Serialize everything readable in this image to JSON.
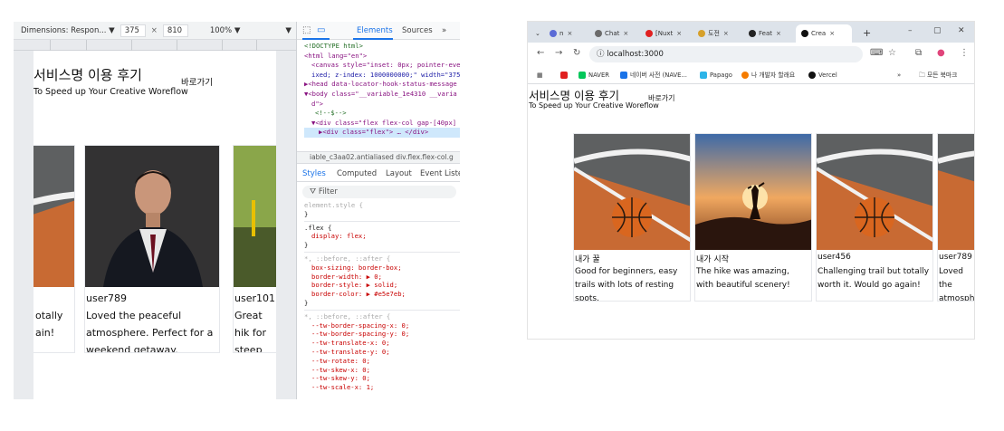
{
  "left": {
    "emulation": {
      "device": "Dimensions: Respon...",
      "width": "375",
      "height": "810",
      "zoom": "100%"
    },
    "devtools": {
      "tabs": [
        "Elements",
        "Sources"
      ],
      "dom_lines": [
        "<!DOCTYPE html>",
        "<html lang=\"en\">",
        "<canvas style=\"inset: 0px; pointer-eve",
        "ixed; z-index: 1000000000;\" width=\"375",
        "▶<head data-locator-hook-status-message",
        "▼<body class=\"__variable_1e4310 __varia",
        "d\">",
        "<!--$-->",
        "▼<div class=\"flex flex-col gap-[40px]",
        "▶<div class=\"flex\"> … </div>"
      ],
      "breadcrumb": "iable_c3aa02.antialiased   div.flex.flex-col.g",
      "subtabs": [
        "Styles",
        "Computed",
        "Layout",
        "Event Listen"
      ],
      "filter_placeholder": "Filter",
      "style_lines": [
        "element.style {",
        "}",
        ".flex {",
        "display: flex;",
        "}",
        "*, ::before, ::after {",
        "box-sizing: border-box;",
        "border-width: ▶ 0;",
        "border-style: ▶ solid;",
        "border-color: ▶ #e5e7eb;",
        "}",
        "*, ::before, ::after {",
        "--tw-border-spacing-x: 0;",
        "--tw-border-spacing-y: 0;",
        "--tw-translate-x: 0;",
        "--tw-translate-y: 0;",
        "--tw-rotate: 0;",
        "--tw-skew-x: 0;",
        "--tw-skew-y: 0;",
        "--tw-scale-x: 1;"
      ]
    },
    "page": {
      "title": "서비스명 이용 후기",
      "link": "바로가기",
      "subtitle": "To Speed up Your Creative Woreflow",
      "cards": [
        {
          "user": "",
          "desc": "otally ain!"
        },
        {
          "user": "user789",
          "desc": "Loved the peaceful atmosphere. Perfect for a weekend getaway."
        },
        {
          "user": "user101",
          "desc": "Great hik for steep"
        }
      ]
    }
  },
  "right": {
    "tabs": [
      {
        "label": "n",
        "color": "#5b6bd6"
      },
      {
        "label": "Chat",
        "color": "#6b6b6b"
      },
      {
        "label": "[Nuxt",
        "color": "#e02020"
      },
      {
        "label": "도전",
        "color": "#d6a02a"
      },
      {
        "label": "Feat",
        "color": "#222222"
      },
      {
        "label": "Crea",
        "color": "#111111",
        "active": true
      }
    ],
    "url": "localhost:3000",
    "bookmarks": [
      {
        "label": "",
        "color": "#e02020"
      },
      {
        "label": "NAVER",
        "color": "#03c75a"
      },
      {
        "label": "네이버 사전 (NAVE...",
        "color": "#1a73e8"
      },
      {
        "label": "Papago",
        "color": "#2db4e8"
      },
      {
        "label": "나 개발자 할래요",
        "color": "#f57c00"
      },
      {
        "label": "Vercel",
        "color": "#111111"
      }
    ],
    "all_bookmarks": "모든 북마크",
    "page": {
      "title": "서비스명 이용 후기",
      "link": "바로가기",
      "subtitle": "To Speed up Your Creative Woreflow",
      "cards": [
        {
          "user": "내가 꿀",
          "desc": "Good for beginners, easy trails with lots of resting spots.",
          "image": "basketball"
        },
        {
          "user": "내가 시작",
          "desc": "The hike was amazing, with beautiful scenery!",
          "image": "sunset"
        },
        {
          "user": "user456",
          "desc": "Challenging trail but totally worth it. Would go again!",
          "image": "basketball"
        },
        {
          "user": "user789",
          "desc": "Loved the atmosphere weekend",
          "image": "basketball"
        }
      ]
    }
  }
}
